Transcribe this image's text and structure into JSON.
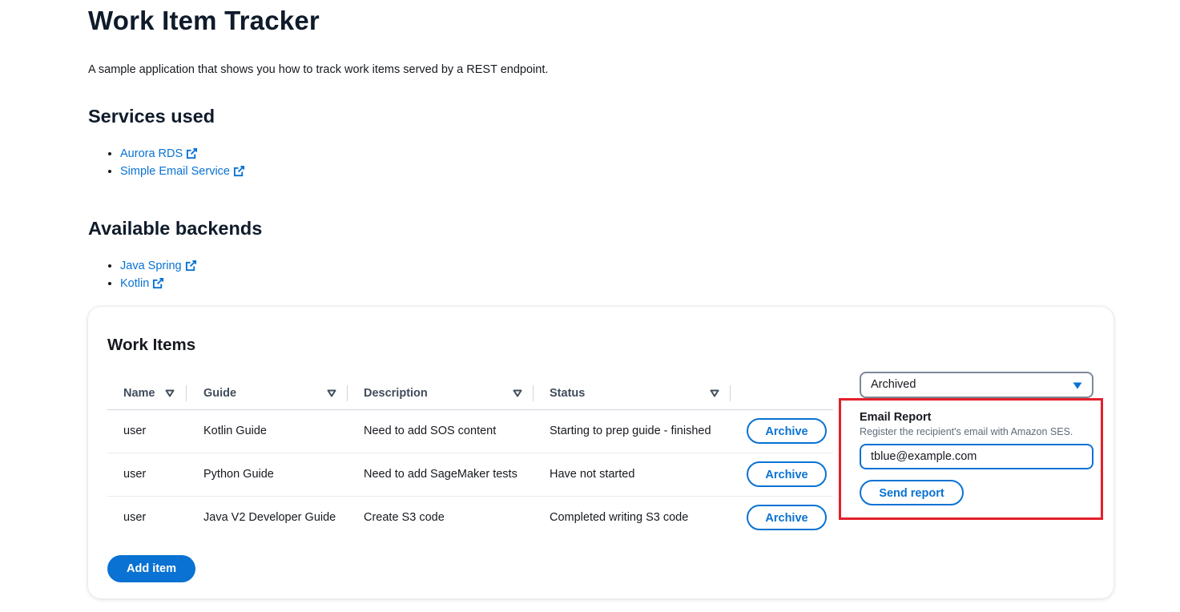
{
  "page": {
    "title": "Work Item Tracker",
    "intro": "A sample application that shows you how to track work items served by a REST endpoint."
  },
  "services": {
    "heading": "Services used",
    "links": [
      {
        "label": "Aurora RDS",
        "icon": "external-link-icon"
      },
      {
        "label": "Simple Email Service",
        "icon": "external-link-icon"
      }
    ]
  },
  "backends": {
    "heading": "Available backends",
    "links": [
      {
        "label": "Java Spring",
        "icon": "external-link-icon"
      },
      {
        "label": "Kotlin",
        "icon": "external-link-icon"
      }
    ]
  },
  "work_items": {
    "heading": "Work Items",
    "columns": [
      "Name",
      "Guide",
      "Description",
      "Status"
    ],
    "rows": [
      {
        "name": "user",
        "guide": "Kotlin Guide",
        "description": "Need to add SOS content",
        "status": "Starting to prep guide - finished",
        "action": "Archive"
      },
      {
        "name": "user",
        "guide": "Python Guide",
        "description": "Need to add SageMaker tests",
        "status": "Have not started",
        "action": "Archive"
      },
      {
        "name": "user",
        "guide": "Java V2 Developer Guide",
        "description": "Create S3 code",
        "status": "Completed writing S3 code",
        "action": "Archive"
      }
    ],
    "add_button": "Add item"
  },
  "filter": {
    "selected": "Archived"
  },
  "email_report": {
    "title": "Email Report",
    "description": "Register the recipient's email with Amazon SES.",
    "email_value": "tblue@example.com",
    "send_button": "Send report"
  },
  "colors": {
    "accent": "#0972d3",
    "highlight_border": "#e3202b",
    "heading": "#0f1b2a"
  }
}
